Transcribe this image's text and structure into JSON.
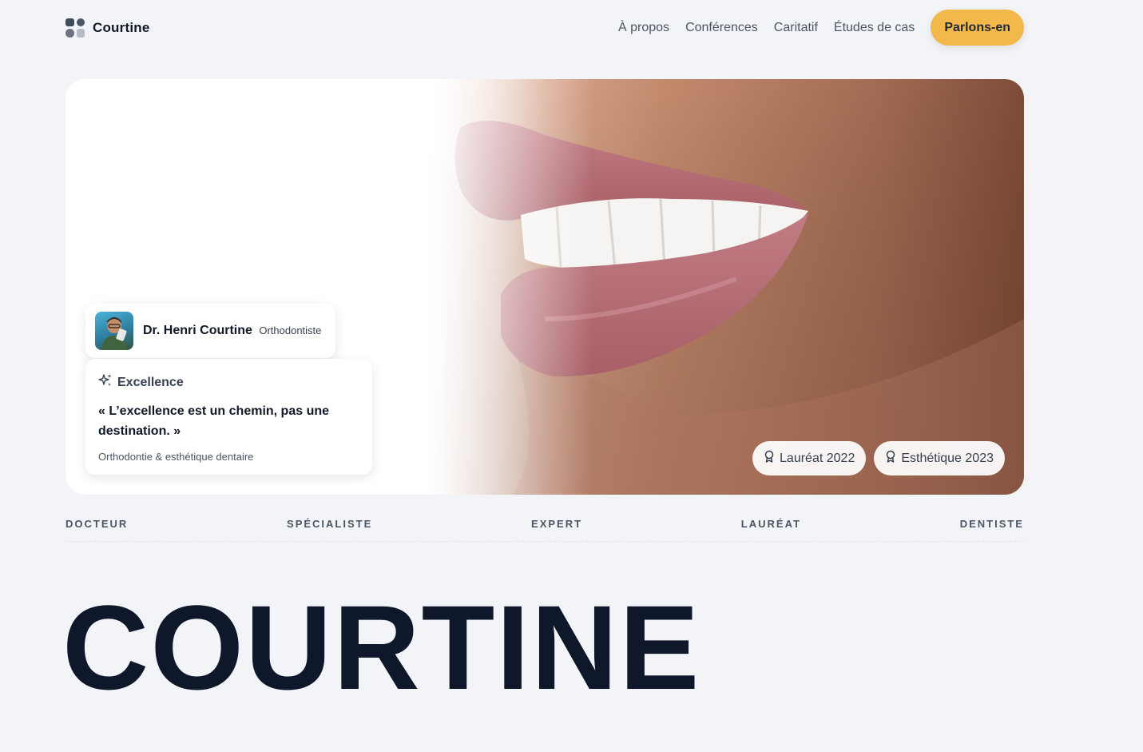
{
  "header": {
    "brand": "Courtine",
    "nav": [
      "À propos",
      "Conférences",
      "Caritatif",
      "Études de cas"
    ],
    "cta": "Parlons-en"
  },
  "hero": {
    "profile": {
      "name": "Dr. Henri Courtine",
      "role": "Orthodontiste"
    },
    "quote": {
      "icon": "sparkles-icon",
      "title": "Excellence",
      "text": "« L’excellence est un chemin, pas une destination. »",
      "subtitle": "Orthodontie & esthétique dentaire"
    },
    "badges": [
      {
        "icon": "award-icon",
        "label": "Lauréat 2022"
      },
      {
        "icon": "award-icon",
        "label": "Esthétique 2023"
      }
    ]
  },
  "marquee": [
    "DOCTEUR",
    "SPÉCIALISTE",
    "EXPERT",
    "LAURÉAT",
    "DENTISTE"
  ],
  "display_title": "COURTINE",
  "colors": {
    "accent": "#f3b84a",
    "background": "#f2f4f7",
    "heading": "#0f172a"
  }
}
